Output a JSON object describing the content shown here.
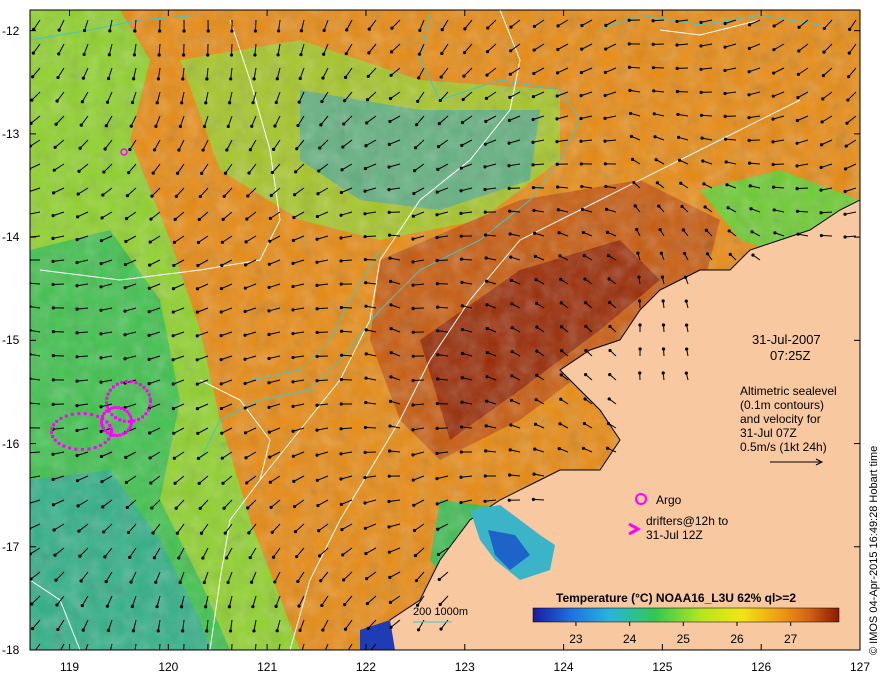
{
  "map": {
    "lon_ticks": [
      "119",
      "120",
      "121",
      "122",
      "123",
      "124",
      "125",
      "126",
      "127"
    ],
    "lat_ticks": [
      "-12",
      "-13",
      "-14",
      "-15",
      "-16",
      "-17",
      "-18"
    ],
    "lon_range": [
      118.6,
      127
    ],
    "lat_range": [
      -11.8,
      -18
    ],
    "colors": {
      "land": "#f8c8a0",
      "sst_cold": "#1010a0",
      "sst_warm": "#8b1a00",
      "current_vector": "#000000",
      "drifter": "#ff00ff",
      "contour_sealevel": "#ffffff",
      "contour_depth": "#40c8c8"
    }
  },
  "date": "31-Jul-2007",
  "time": "07:25Z",
  "info_lines": [
    "Altimetric sealevel",
    "(0.1m contours)",
    "and velocity for",
    "31-Jul 07Z",
    "0.5m/s (1kt 24h)"
  ],
  "legend": {
    "argo_label": "Argo",
    "drifter_lines": [
      "drifters@12h to",
      "31-Jul 12Z"
    ],
    "drifter_symbol": ">"
  },
  "depth_label": "200  1000m",
  "colorbar": {
    "title": "Temperature (°C) NOAA16_L3U 62% ql>=2",
    "ticks": [
      "23",
      "24",
      "25",
      "26",
      "27"
    ],
    "range": [
      22.2,
      27.9
    ]
  },
  "copyright": "© IMOS 04-Apr-2015 16:49:28 Hobart time"
}
